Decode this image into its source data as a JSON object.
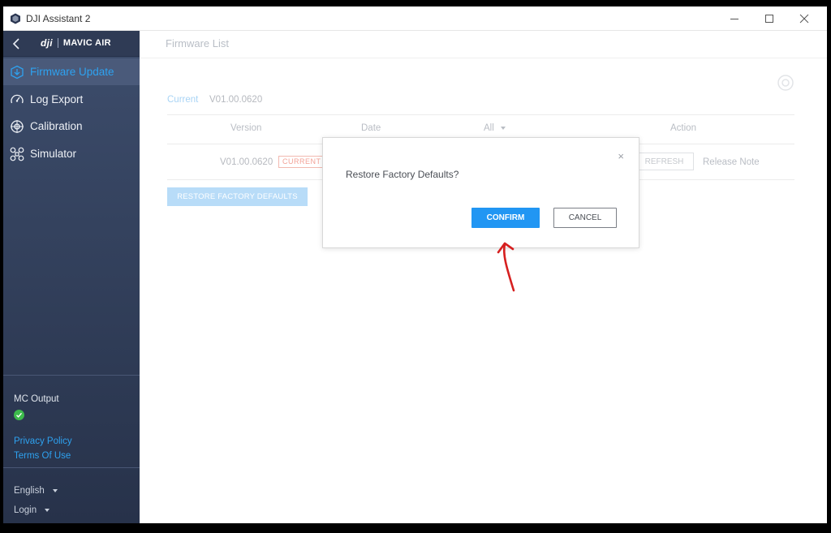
{
  "window": {
    "title": "DJI Assistant 2",
    "minimize_icon": "minimize-icon",
    "maximize_icon": "maximize-icon",
    "close_icon": "close-icon"
  },
  "sidebar": {
    "brand_logo": "dji",
    "brand_product": "MAVIC AIR",
    "items": [
      {
        "label": "Firmware Update",
        "icon": "firmware-icon",
        "active": true
      },
      {
        "label": "Log Export",
        "icon": "log-export-icon",
        "active": false
      },
      {
        "label": "Calibration",
        "icon": "calibration-icon",
        "active": false
      },
      {
        "label": "Simulator",
        "icon": "drone-icon",
        "active": false
      }
    ],
    "mc_output_label": "MC Output",
    "mc_output_status": "ok",
    "privacy_policy": "Privacy Policy",
    "terms_of_use": "Terms Of Use",
    "language": "English",
    "login": "Login"
  },
  "main": {
    "title": "Firmware List",
    "current_label": "Current",
    "current_version": "V01.00.0620",
    "columns": {
      "version": "Version",
      "date": "Date",
      "filter": "All",
      "action": "Action"
    },
    "row": {
      "version": "V01.00.0620",
      "badge": "CURRENT",
      "refresh": "REFRESH",
      "release_note": "Release Note"
    },
    "restore_button": "RESTORE FACTORY DEFAULTS"
  },
  "dialog": {
    "message": "Restore Factory Defaults?",
    "close": "×",
    "confirm": "CONFIRM",
    "cancel": "CANCEL"
  },
  "colors": {
    "accent": "#2196f3",
    "sidebar": "#34425e",
    "annotation": "#d62020"
  }
}
